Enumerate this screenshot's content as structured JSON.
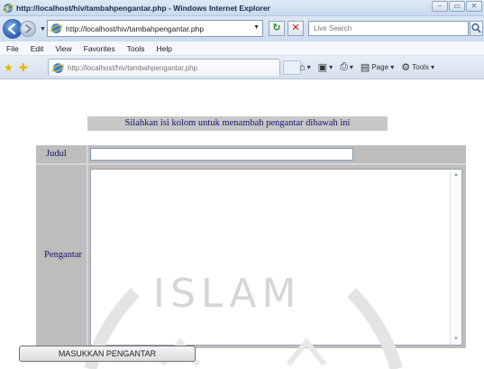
{
  "window": {
    "title": "http://localhost/hiv/tambahpengantar.php - Windows Internet Explorer",
    "controls": [
      "–",
      "▭",
      "✕"
    ]
  },
  "address_bar": {
    "url": "http://localhost/hiv/tambahpengantar.php",
    "search_placeholder": "Live Search"
  },
  "menu": {
    "items": [
      "File",
      "Edit",
      "View",
      "Favorites",
      "Tools",
      "Help"
    ]
  },
  "favorites_bar": {
    "tab_url": "http://localhost/hiv/tambahpengantar.php",
    "commands": {
      "page": "Page",
      "tools": "Tools"
    }
  },
  "page": {
    "heading": "Silahkan isi kolom untuk menambah pengantar dibawah ini",
    "form": {
      "judul_label": "Judul",
      "judul_value": "",
      "pengantar_label": "Pengantar",
      "pengantar_value": "",
      "submit_label": "MASUKKAN PENGANTAR"
    },
    "watermark": "ISLAM"
  },
  "colors": {
    "label_text": "#141470",
    "table_bg": "#bdbdbd",
    "heading_bg": "#c7c7c7"
  },
  "icons": [
    "ie-logo-icon",
    "back-icon",
    "forward-icon",
    "page-icon",
    "refresh-icon",
    "stop-icon",
    "search-icon",
    "favorites-star-icon",
    "add-favorites-icon",
    "home-icon",
    "feeds-icon",
    "print-icon",
    "page-menu-icon",
    "tools-icon"
  ]
}
